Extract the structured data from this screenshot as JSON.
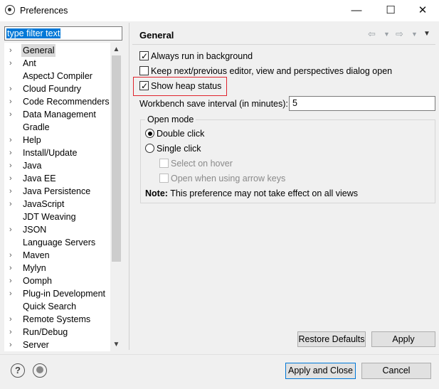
{
  "window": {
    "title": "Preferences",
    "minimize_glyph": "—",
    "maximize_glyph": "☐",
    "close_glyph": "✕"
  },
  "filter": {
    "value": "type filter text"
  },
  "tree": {
    "items": [
      {
        "label": "General",
        "expandable": true,
        "selected": true
      },
      {
        "label": "Ant",
        "expandable": true
      },
      {
        "label": "AspectJ Compiler",
        "expandable": false
      },
      {
        "label": "Cloud Foundry",
        "expandable": true
      },
      {
        "label": "Code Recommenders",
        "expandable": true
      },
      {
        "label": "Data Management",
        "expandable": true
      },
      {
        "label": "Gradle",
        "expandable": false
      },
      {
        "label": "Help",
        "expandable": true
      },
      {
        "label": "Install/Update",
        "expandable": true
      },
      {
        "label": "Java",
        "expandable": true
      },
      {
        "label": "Java EE",
        "expandable": true
      },
      {
        "label": "Java Persistence",
        "expandable": true
      },
      {
        "label": "JavaScript",
        "expandable": true
      },
      {
        "label": "JDT Weaving",
        "expandable": false
      },
      {
        "label": "JSON",
        "expandable": true
      },
      {
        "label": "Language Servers",
        "expandable": false
      },
      {
        "label": "Maven",
        "expandable": true
      },
      {
        "label": "Mylyn",
        "expandable": true
      },
      {
        "label": "Oomph",
        "expandable": true
      },
      {
        "label": "Plug-in Development",
        "expandable": true
      },
      {
        "label": "Quick Search",
        "expandable": false
      },
      {
        "label": "Remote Systems",
        "expandable": true
      },
      {
        "label": "Run/Debug",
        "expandable": true
      },
      {
        "label": "Server",
        "expandable": true
      }
    ]
  },
  "page": {
    "title": "General",
    "options": {
      "always_run_bg": {
        "label": "Always run in background",
        "checked": true
      },
      "keep_next_prev": {
        "label": "Keep next/previous editor, view and perspectives dialog open",
        "checked": false
      },
      "show_heap": {
        "label": "Show heap status",
        "checked": true
      }
    },
    "workbench_label": "Workbench save interval (in minutes):",
    "workbench_value": "5",
    "open_mode": {
      "title": "Open mode",
      "double_click": "Double click",
      "single_click": "Single click",
      "select_on_hover": "Select on hover",
      "open_with_arrows": "Open when using arrow keys"
    },
    "note_bold": "Note:",
    "note_text": " This preference may not take effect on all views",
    "restore_defaults": "Restore Defaults",
    "apply": "Apply"
  },
  "footer": {
    "apply_close": "Apply and Close",
    "cancel": "Cancel",
    "help_glyph": "?"
  },
  "colors": {
    "highlight": "#e0242d",
    "selection": "#0078d7"
  }
}
